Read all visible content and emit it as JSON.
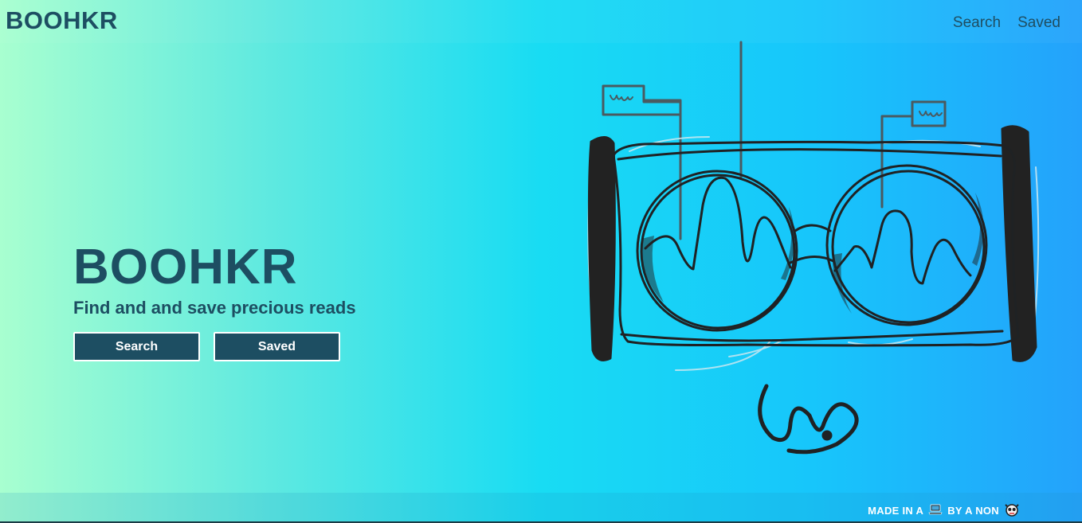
{
  "navbar": {
    "brand": "BOOHKR",
    "links": [
      "Search",
      "Saved"
    ]
  },
  "hero": {
    "title": "BOOHKR",
    "subtitle": "Find and and save precious reads",
    "buttons": [
      "Search",
      "Saved"
    ]
  },
  "footer": {
    "made_in": "MADE IN A",
    "laptop_icon": "laptop-icon",
    "by": "BY A NON",
    "mascot_icon": "skull-mascot-icon"
  },
  "colors": {
    "brand": "#1d4e62",
    "gradient_start": "#a8ffd0",
    "gradient_mid": "#18dcf3",
    "gradient_end": "#24a2fb",
    "button_text": "#ffffff"
  }
}
